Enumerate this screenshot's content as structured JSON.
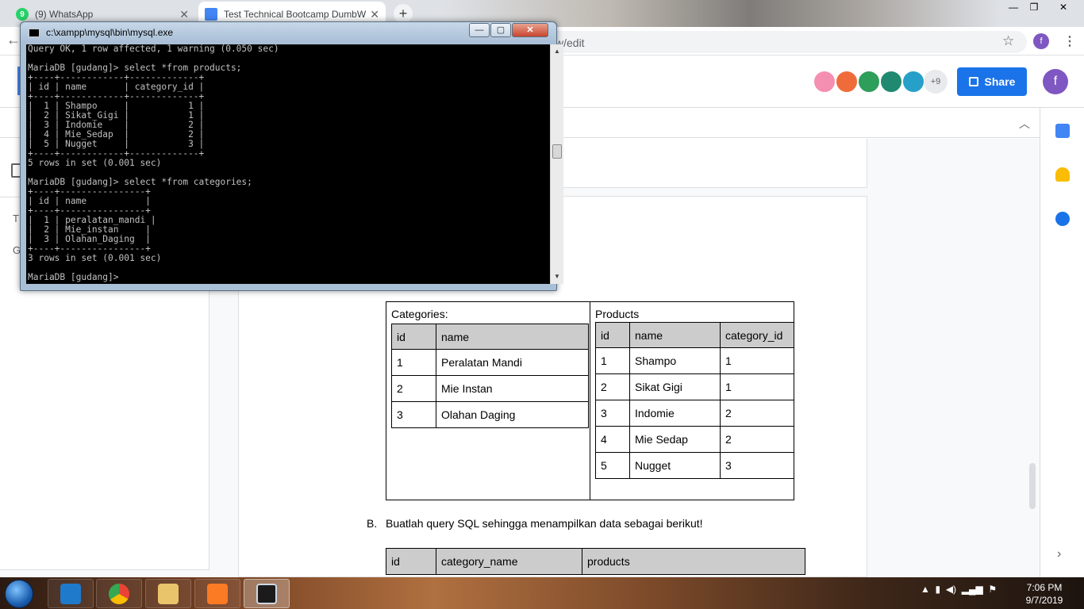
{
  "browser": {
    "tabs": [
      {
        "title": "(9) WhatsApp",
        "badge": "9"
      },
      {
        "title": "Test Technical Bootcamp DumbW"
      }
    ],
    "url_suffix": "w/edit",
    "profile_initial": "f",
    "window_controls": {
      "minimize": "—",
      "maximize": "❐",
      "close": "✕"
    }
  },
  "docs": {
    "share_label": "Share",
    "collaborators_more": "+9",
    "profile_initial": "f",
    "outline_letters": [
      "T",
      "G"
    ]
  },
  "console": {
    "title": "c:\\xampp\\mysql\\bin\\mysql.exe",
    "lines": [
      "Query OK, 1 row affected, 1 warning (0.050 sec)",
      "",
      "MariaDB [gudang]> select *from products;",
      "+----+------------+-------------+",
      "| id | name       | category_id |",
      "+----+------------+-------------+",
      "|  1 | Shampo     |           1 |",
      "|  2 | Sikat_Gigi |           1 |",
      "|  3 | Indomie    |           2 |",
      "|  4 | Mie_Sedap  |           2 |",
      "|  5 | Nugget     |           3 |",
      "+----+------------+-------------+",
      "5 rows in set (0.001 sec)",
      "",
      "MariaDB [gudang]> select *from categories;",
      "+----+----------------+",
      "| id | name           |",
      "+----+----------------+",
      "|  1 | peralatan_mandi |",
      "|  2 | Mie_instan     |",
      "|  3 | Olahan_Daging  |",
      "+----+----------------+",
      "3 rows in set (0.001 sec)",
      "",
      "MariaDB [gudang]>"
    ]
  },
  "document": {
    "categories": {
      "caption": "Categories:",
      "headers": [
        "id",
        "name"
      ],
      "rows": [
        [
          "1",
          "Peralatan Mandi"
        ],
        [
          "2",
          "Mie Instan"
        ],
        [
          "3",
          "Olahan Daging"
        ]
      ]
    },
    "products": {
      "caption": "Products",
      "headers": [
        "id",
        "name",
        "category_id"
      ],
      "rows": [
        [
          "1",
          "Shampo",
          "1"
        ],
        [
          "2",
          "Sikat Gigi",
          "1"
        ],
        [
          "3",
          "Indomie",
          "2"
        ],
        [
          "4",
          "Mie Sedap",
          "2"
        ],
        [
          "5",
          "Nugget",
          "3"
        ]
      ]
    },
    "question_b": {
      "letter": "B.",
      "text": "Buatlah query SQL sehingga menampilkan data sebagai berikut!"
    },
    "result_headers": [
      "id",
      "category_name",
      "products"
    ]
  },
  "taskbar": {
    "time": "7:06 PM",
    "date": "9/7/2019"
  }
}
